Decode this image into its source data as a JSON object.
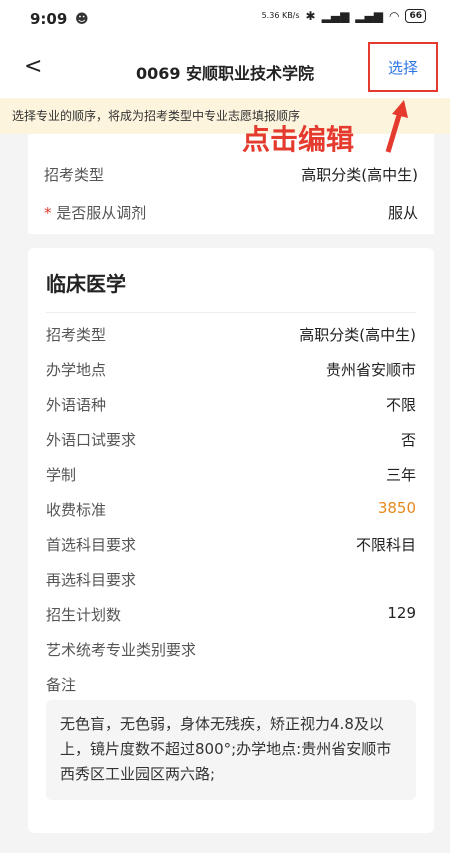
{
  "status": {
    "time": "9:09",
    "speed": "5.36 KB/s",
    "battery": "66"
  },
  "nav": {
    "title": "0069 安顺职业技术学院",
    "back": "<",
    "select_label": "选择"
  },
  "notice": "选择专业的顺序，将成为招考类型中专业志愿填报顺序",
  "annotation": "点击编辑",
  "colors": {
    "annotation": "#e53a2e",
    "link": "#2f76e6",
    "fee": "#e7891d",
    "notice_bg": "#fdf4de"
  },
  "top_card": {
    "exam_type_label": "招考类型",
    "exam_type_value": "高职分类(高中生)",
    "req_mark": "*",
    "adjust_label": "是否服从调剂",
    "adjust_value": "服从"
  },
  "major": {
    "name": "临床医学",
    "rows": [
      {
        "label": "招考类型",
        "value": "高职分类(高中生)"
      },
      {
        "label": "办学地点",
        "value": "贵州省安顺市"
      },
      {
        "label": "外语语种",
        "value": "不限"
      },
      {
        "label": "外语口试要求",
        "value": "否"
      },
      {
        "label": "学制",
        "value": "三年"
      },
      {
        "label": "收费标准",
        "value": "3850"
      },
      {
        "label": "首选科目要求",
        "value": "不限科目"
      },
      {
        "label": "再选科目要求",
        "value": ""
      },
      {
        "label": "招生计划数",
        "value": "129"
      },
      {
        "label": "艺术统考专业类别要求",
        "value": ""
      },
      {
        "label": "备注",
        "value": ""
      }
    ],
    "note": "无色盲，无色弱，身体无残疾，矫正视力4.8及以上，镜片度数不超过800°;办学地点:贵州省安顺市西秀区工业园区两六路;"
  }
}
